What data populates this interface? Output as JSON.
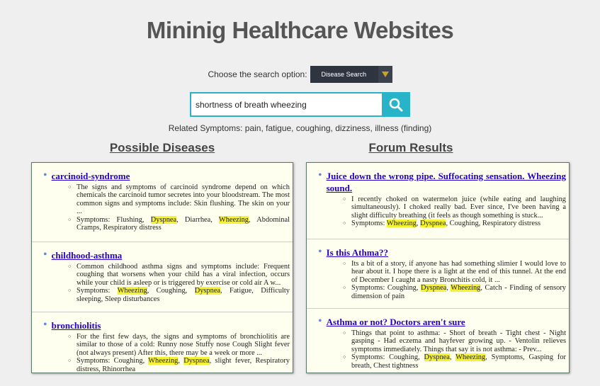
{
  "app_title": "Mininig Healthcare Websites",
  "search_option": {
    "label": "Choose the search option:",
    "selected": "Disease Search"
  },
  "search": {
    "value": "shortness of breath wheezing"
  },
  "related_symptoms": "Related Symptoms: pain, fatigue, coughing, dizziness, illness (finding)",
  "diseases": {
    "heading": "Possible Diseases",
    "items": [
      {
        "title": "carcinoid-syndrome",
        "description": "The signs and symptoms of carcinoid syndrome depend on which chemicals the carcinoid tumor secretes into your bloodstream. The most common signs and symptoms include: Skin flushing. The skin on your ...",
        "symptoms_prefix": "Symptoms: Flushing, ",
        "s1": "Dyspnea",
        "mid1": ", Diarrhea, ",
        "s2": "Wheezing",
        "suffix": ", Abdominal Cramps, Respiratory distress"
      },
      {
        "title": "childhood-asthma",
        "description": "Common childhood asthma signs and symptoms include: Frequent coughing that worsens when your child has a viral infection, occurs while your child is asleep or is triggered by exercise or cold air A w...",
        "symptoms_prefix": "Symptoms: ",
        "s1": "Wheezing",
        "mid1": ", Coughing, ",
        "s2": "Dyspnea",
        "suffix": ", Fatigue, Difficulty sleeping, Sleep disturbances"
      },
      {
        "title": "bronchiolitis",
        "description": "For the first few days, the signs and symptoms of bronchiolitis are similar to those of a cold: Runny nose Stuffy nose Cough Slight fever (not always present) After this, there may be a week or more ...",
        "symptoms_prefix": "Symptoms: Coughing, ",
        "s1": "Wheezing",
        "mid1": ", ",
        "s2": "Dyspnea",
        "suffix": ", slight fever, Respiratory distress, Rhinorrhea"
      }
    ]
  },
  "forum": {
    "heading": "Forum Results",
    "items": [
      {
        "title": "Juice down the wrong pipe. Suffocating sensation. Wheezing sound.",
        "description": "I recently choked on watermelon juice (while eating and laughing simultaneously). I choked really bad. Ever since, I've been having a slight difficulty breathing (it feels as though something is stuck...",
        "symptoms_prefix": "Symptoms: ",
        "s1": "Wheezing",
        "mid1": ", ",
        "s2": "Dyspnea",
        "suffix": ", Coughing, Respiratory distress"
      },
      {
        "title": "Is this Athma??",
        "description": "Its a bit of a story, if anyone has had something slimier I would love to hear about it. I hope there is a light at the end of this tunnel. At the end of December I caught a nasty Bronchitis cold, it ...",
        "symptoms_prefix": "Symptoms: Coughing, ",
        "s1": "Dyspnea",
        "mid1": ", ",
        "s2": "Wheezing",
        "suffix": ", Catch - Finding of sensory dimension of pain"
      },
      {
        "title": "Asthma or not? Doctors aren't sure",
        "description": "Things that point to asthma: - Short of breath - Tight chest - Night gasping - Had eczema and hayfever growing up. - Ventolin relieves symptoms immediately. Things that say it is not asthma: - Prev...",
        "symptoms_prefix": "Symptoms: Coughing, ",
        "s1": "Dyspnea",
        "mid1": ", ",
        "s2": "Wheezing",
        "suffix": ", Symptoms, Gasping for breath, Chest tightness"
      }
    ]
  }
}
